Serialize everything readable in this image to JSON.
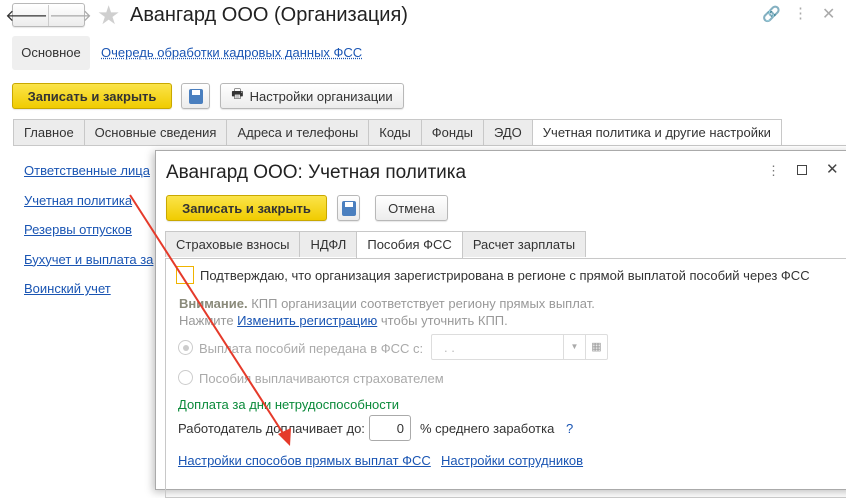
{
  "window": {
    "title": "Авангард ООО (Организация)"
  },
  "sections": {
    "main": "Основное",
    "queue_link": "Очередь обработки кадровых данных ФСС"
  },
  "toolbar": {
    "save_close": "Записать и закрыть",
    "org_settings": "Настройки организации"
  },
  "tabs": [
    "Главное",
    "Основные сведения",
    "Адреса и телефоны",
    "Коды",
    "Фонды",
    "ЭДО",
    "Учетная политика и другие настройки"
  ],
  "left_links": [
    "Ответственные лица",
    "Учетная политика",
    "Резервы отпусков",
    "Бухучет и выплата за",
    "Воинский учет"
  ],
  "dialog": {
    "title": "Авангард ООО: Учетная политика",
    "save_close": "Записать и закрыть",
    "cancel": "Отмена",
    "tabs": [
      "Страховые взносы",
      "НДФЛ",
      "Пособия ФСС",
      "Расчет зарплаты"
    ],
    "confirm_checkbox": "Подтверждаю, что организация зарегистрирована в регионе с прямой выплатой пособий через ФСС",
    "warning_bold": "Внимание.",
    "warning_text": " КПП организации соответствует региону прямых выплат.",
    "press": "Нажмите ",
    "change_reg_link": "Изменить регистрацию",
    "press_suffix": " чтобы уточнить КПП.",
    "radio1": "Выплата пособий передана в ФСС с:",
    "date_value": " .  .",
    "radio2": "Пособия выплачиваются страхователем",
    "section_title": "Доплата за дни нетрудоспособности",
    "employer_label": "Работодатель доплачивает до:",
    "employer_value": "0",
    "percent_label": "% среднего заработка",
    "help": "?",
    "link1": "Настройки способов прямых выплат ФСС",
    "link2": "Настройки сотрудников"
  },
  "colors": {
    "accent": "#f5d90f",
    "link": "#1a55b3",
    "green": "#0a8a3a",
    "arrow": "#e53a2a"
  }
}
